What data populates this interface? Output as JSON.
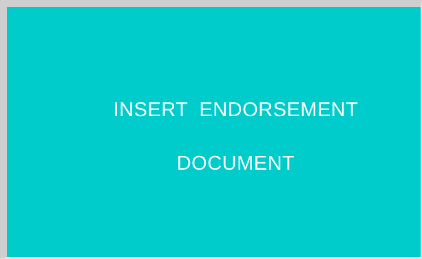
{
  "screen": {
    "background_color": "#00cccc",
    "text_color": "#ffffff",
    "message_line_1": "INSERT  ENDORSEMENT",
    "message_line_2": "DOCUMENT"
  }
}
